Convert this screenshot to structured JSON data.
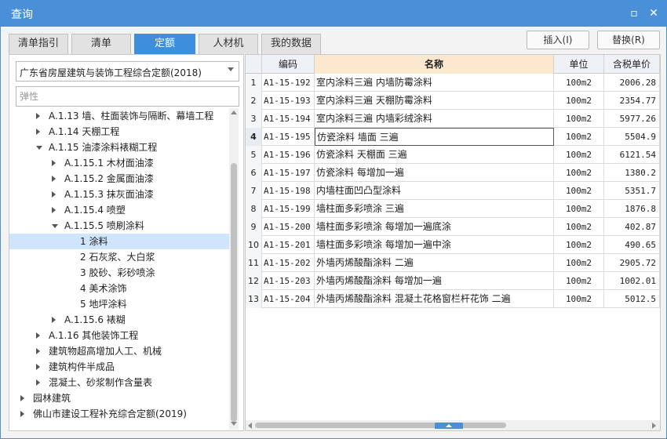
{
  "window": {
    "title": "查询",
    "minimize_glyph": "▫",
    "close_glyph": "✕"
  },
  "tabs": [
    {
      "label": "清单指引",
      "active": false
    },
    {
      "label": "清单",
      "active": false
    },
    {
      "label": "定额",
      "active": true
    },
    {
      "label": "人材机",
      "active": false
    },
    {
      "label": "我的数据",
      "active": false
    }
  ],
  "actions": {
    "insert": "插入(I)",
    "replace": "替换(R)"
  },
  "left": {
    "quota_library": "广东省房屋建筑与装饰工程综合定额(2018)",
    "search_value": "弹性"
  },
  "tree": [
    {
      "label": "A.1.13 墙、柱面装饰与隔断、幕墙工程",
      "toggle": "closed"
    },
    {
      "label": "A.1.14 天棚工程",
      "toggle": "closed"
    },
    {
      "label": "A.1.15 油漆涂料裱糊工程",
      "toggle": "open"
    },
    {
      "label": "A.1.15.1 木材面油漆",
      "toggle": "closed"
    },
    {
      "label": "A.1.15.2 金属面油漆",
      "toggle": "closed"
    },
    {
      "label": "A.1.15.3 抹灰面油漆",
      "toggle": "closed"
    },
    {
      "label": "A.1.15.4 喷塑",
      "toggle": "closed"
    },
    {
      "label": "A.1.15.5 喷刷涂料",
      "toggle": "open"
    },
    {
      "label": "1 涂料",
      "toggle": "none",
      "selected": true
    },
    {
      "label": "2 石灰浆、大白浆",
      "toggle": "none"
    },
    {
      "label": "3 胶砂、彩砂喷涂",
      "toggle": "none"
    },
    {
      "label": "4 美术涂饰",
      "toggle": "none"
    },
    {
      "label": "5 地坪涂料",
      "toggle": "none"
    },
    {
      "label": "A.1.15.6 裱糊",
      "toggle": "closed"
    },
    {
      "label": "A.1.16 其他装饰工程",
      "toggle": "closed"
    },
    {
      "label": "建筑物超高增加人工、机械",
      "toggle": "closed"
    },
    {
      "label": "建筑构件半成品",
      "toggle": "closed"
    },
    {
      "label": "混凝土、砂浆制作含量表",
      "toggle": "closed"
    },
    {
      "label": "园林建筑",
      "toggle": "closed"
    },
    {
      "label": "佛山市建设工程补充综合定额(2019)",
      "toggle": "closed"
    }
  ],
  "grid": {
    "headers": {
      "code": "编码",
      "name": "名称",
      "unit": "单位",
      "price": "含税单价"
    },
    "current_row": 4,
    "rows": [
      {
        "idx": "1",
        "code": "A1-15-192",
        "name": "室内涂料三遍  内墙防霉涂料",
        "unit": "100m2",
        "price": "2006.28"
      },
      {
        "idx": "2",
        "code": "A1-15-193",
        "name": "室内涂料三遍  天棚防霉涂料",
        "unit": "100m2",
        "price": "2354.77"
      },
      {
        "idx": "3",
        "code": "A1-15-194",
        "name": "室内涂料三遍  内墙彩绒涂料",
        "unit": "100m2",
        "price": "5977.26"
      },
      {
        "idx": "4",
        "code": "A1-15-195",
        "name": "仿瓷涂料  墙面  三遍",
        "unit": "100m2",
        "price": "5504.9"
      },
      {
        "idx": "5",
        "code": "A1-15-196",
        "name": "仿瓷涂料  天棚面  三遍",
        "unit": "100m2",
        "price": "6121.54"
      },
      {
        "idx": "6",
        "code": "A1-15-197",
        "name": "仿瓷涂料  每增加一遍",
        "unit": "100m2",
        "price": "1380.2"
      },
      {
        "idx": "7",
        "code": "A1-15-198",
        "name": "内墙柱面凹凸型涂料",
        "unit": "100m2",
        "price": "5351.7"
      },
      {
        "idx": "8",
        "code": "A1-15-199",
        "name": "墙柱面多彩喷涂  三遍",
        "unit": "100m2",
        "price": "1876.8"
      },
      {
        "idx": "9",
        "code": "A1-15-200",
        "name": "墙柱面多彩喷涂  每增加一遍底涂",
        "unit": "100m2",
        "price": "402.87"
      },
      {
        "idx": "10",
        "code": "A1-15-201",
        "name": "墙柱面多彩喷涂  每增加一遍中涂",
        "unit": "100m2",
        "price": "490.65"
      },
      {
        "idx": "11",
        "code": "A1-15-202",
        "name": "外墙丙烯酸酯涂料  二遍",
        "unit": "100m2",
        "price": "2905.72"
      },
      {
        "idx": "12",
        "code": "A1-15-203",
        "name": "外墙丙烯酸酯涂料  每增加一遍",
        "unit": "100m2",
        "price": "1002.01"
      },
      {
        "idx": "13",
        "code": "A1-15-204",
        "name": "外墙丙烯酸酯涂料  混凝土花格窗栏杆花饰  二遍",
        "unit": "100m2",
        "price": "5012.5"
      }
    ]
  }
}
